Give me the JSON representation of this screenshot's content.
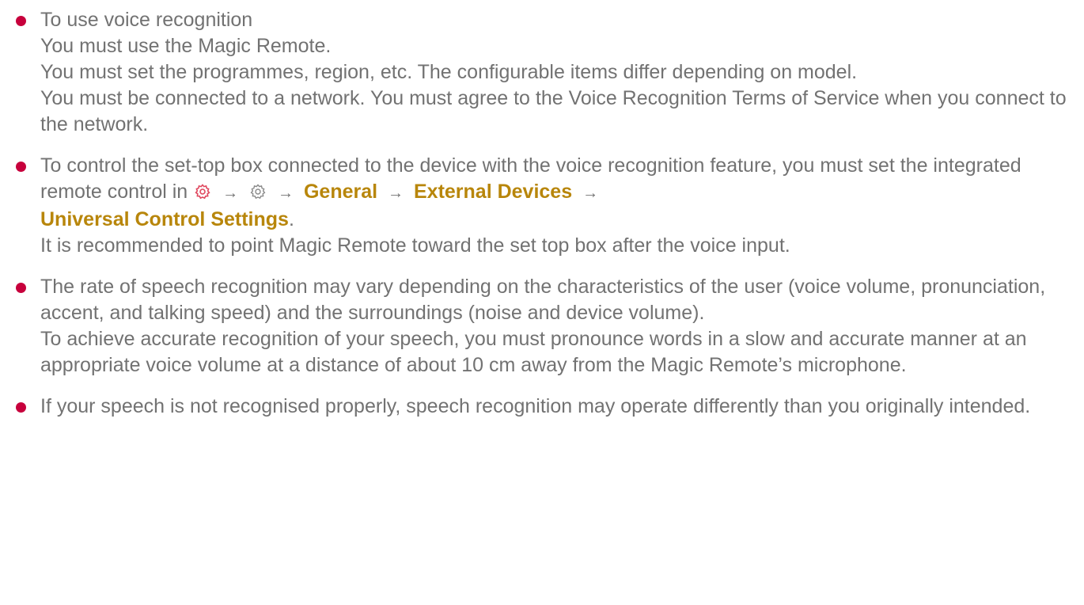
{
  "colors": {
    "text": "#727272",
    "bullet": "#c7003c",
    "menu_link": "#b8860b",
    "settings_icon_primary": "#e0485f",
    "settings_icon_secondary": "#8a8a8a"
  },
  "items": [
    {
      "title": "To use voice recognition",
      "lines": [
        "You must use the Magic Remote.",
        "You must set the programmes, region, etc. The configurable items differ depending on model.",
        "You must be connected to a network. You must agree to the Voice Recognition Terms of Service when you connect to the network."
      ]
    },
    {
      "intro": "To control the set-top box connected to the device with the voice recognition feature, you must set the integrated remote control in",
      "icons": [
        "settings-gear-icon",
        "settings-gear-outline-icon"
      ],
      "arrow": "→",
      "path": [
        "General",
        "External Devices",
        "Universal Control Settings"
      ],
      "path_end": ".",
      "note": "It is recommended to point Magic Remote toward the set top box after the voice input."
    },
    {
      "lines": [
        "The rate of speech recognition may vary depending on the characteristics of the user (voice volume, pronunciation, accent, and talking speed) and the surroundings (noise and device volume).",
        "To achieve accurate recognition of your speech, you must pronounce words in a slow and accurate manner at an appropriate voice volume at a distance of about 10 cm away from the Magic Remote’s microphone."
      ]
    },
    {
      "lines": [
        "If your speech is not recognised properly, speech recognition may operate differently than you originally intended."
      ]
    }
  ]
}
